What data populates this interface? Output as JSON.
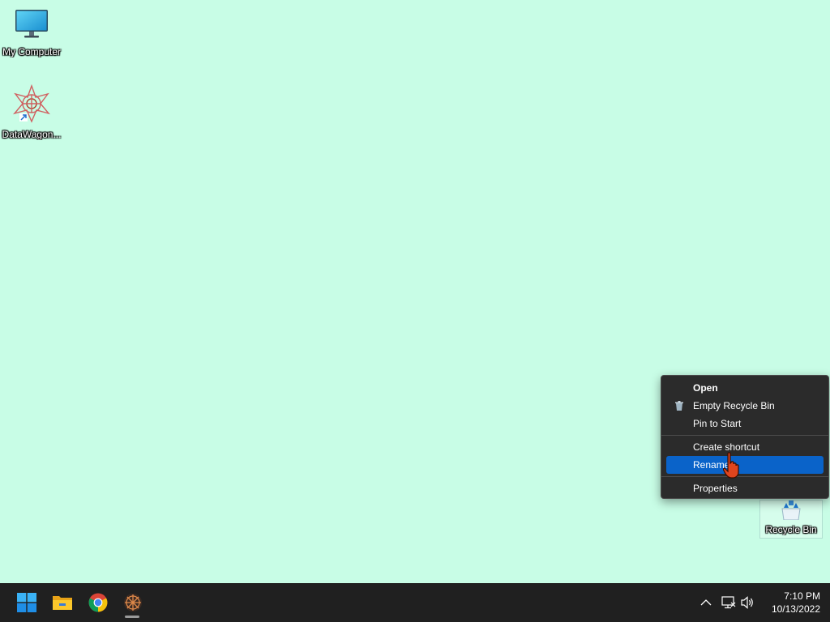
{
  "desktop": {
    "background": "#c8fde6",
    "icons": [
      {
        "label": "My Computer",
        "icon": "monitor-icon"
      },
      {
        "label": "DataWagon...",
        "icon": "datawagon-app-icon"
      },
      {
        "label": "Recycle Bin",
        "icon": "recycle-bin-icon",
        "selected": true
      }
    ]
  },
  "context_menu": {
    "items": [
      {
        "label": "Open",
        "bold": true
      },
      {
        "label": "Empty Recycle Bin",
        "icon": "recycle-bin-small-icon"
      },
      {
        "label": "Pin to Start"
      },
      {
        "label": "Create shortcut"
      },
      {
        "label": "Rename",
        "highlighted": true
      },
      {
        "label": "Properties"
      }
    ],
    "highlight_color": "#0a63c9"
  },
  "taskbar": {
    "apps": [
      {
        "name": "start",
        "icon": "windows-start-icon"
      },
      {
        "name": "file-explorer",
        "icon": "folder-icon"
      },
      {
        "name": "chrome",
        "icon": "chrome-icon"
      },
      {
        "name": "datawagon",
        "icon": "datawagon-app-icon",
        "running": true
      }
    ],
    "tray": {
      "icons": [
        "chevron-up-icon",
        "network-icon",
        "volume-icon"
      ]
    },
    "clock": {
      "time": "7:10 PM",
      "date": "10/13/2022"
    }
  }
}
